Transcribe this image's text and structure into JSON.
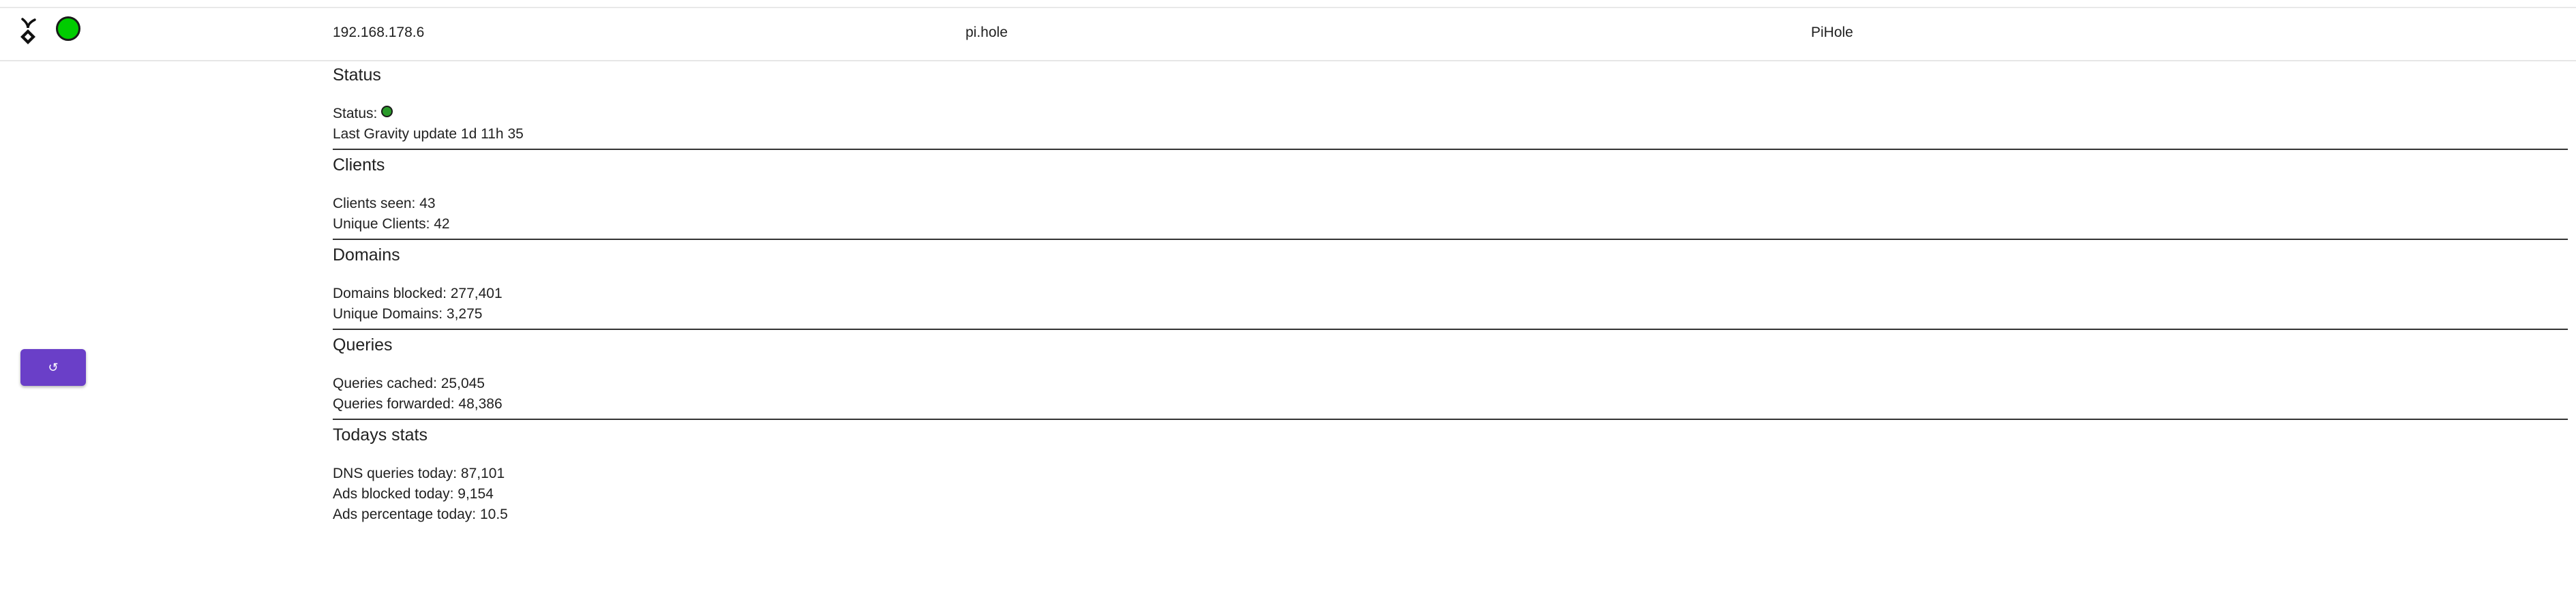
{
  "row": {
    "ip": "192.168.178.6",
    "hostname": "pi.hole",
    "name": "PiHole",
    "status_color": "#00cc00"
  },
  "icons": {
    "app_icon": "pihole-icon",
    "status": "status-dot-icon",
    "refresh": "refresh-icon"
  },
  "refresh_button": {
    "label": "↺",
    "color": "#6a3fc8"
  },
  "sections": {
    "status": {
      "title": "Status",
      "status_label": "Status:",
      "status_color": "#2a9a2a",
      "gravity": "Last Gravity update 1d 11h 35"
    },
    "clients": {
      "title": "Clients",
      "seen": "Clients seen: 43",
      "unique": "Unique Clients: 42"
    },
    "domains": {
      "title": "Domains",
      "blocked": "Domains blocked: 277,401",
      "unique": "Unique Domains: 3,275"
    },
    "queries": {
      "title": "Queries",
      "cached": "Queries cached: 25,045",
      "forwarded": "Queries forwarded: 48,386"
    },
    "today": {
      "title": "Todays stats",
      "dns_queries": "DNS queries today: 87,101",
      "ads_blocked": "Ads blocked today: 9,154",
      "ads_percentage": "Ads percentage today: 10.5"
    }
  }
}
